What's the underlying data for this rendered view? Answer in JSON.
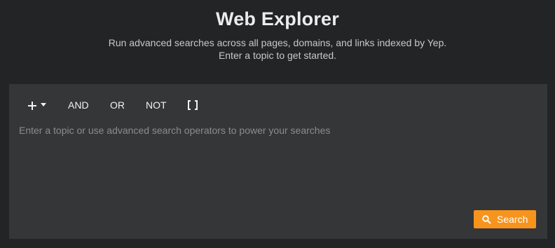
{
  "header": {
    "title": "Web Explorer",
    "subtitle_line1": "Run advanced searches across all pages, domains, and links indexed by Yep.",
    "subtitle_line2": "Enter a topic to get started."
  },
  "toolbar": {
    "add_icon": "plus-icon",
    "dropdown_icon": "caret-down-icon",
    "and_label": "AND",
    "or_label": "OR",
    "not_label": "NOT",
    "group_icon": "brackets-icon"
  },
  "query": {
    "value": "",
    "placeholder": "Enter a topic or use advanced search operators to power your searches"
  },
  "search_button": {
    "label": "Search",
    "icon": "search-icon"
  },
  "colors": {
    "background": "#232425",
    "panel": "#353637",
    "accent": "#f7941d",
    "title": "#ececec",
    "subtitle": "#c9c9c9",
    "placeholder": "#8b8c8d"
  }
}
